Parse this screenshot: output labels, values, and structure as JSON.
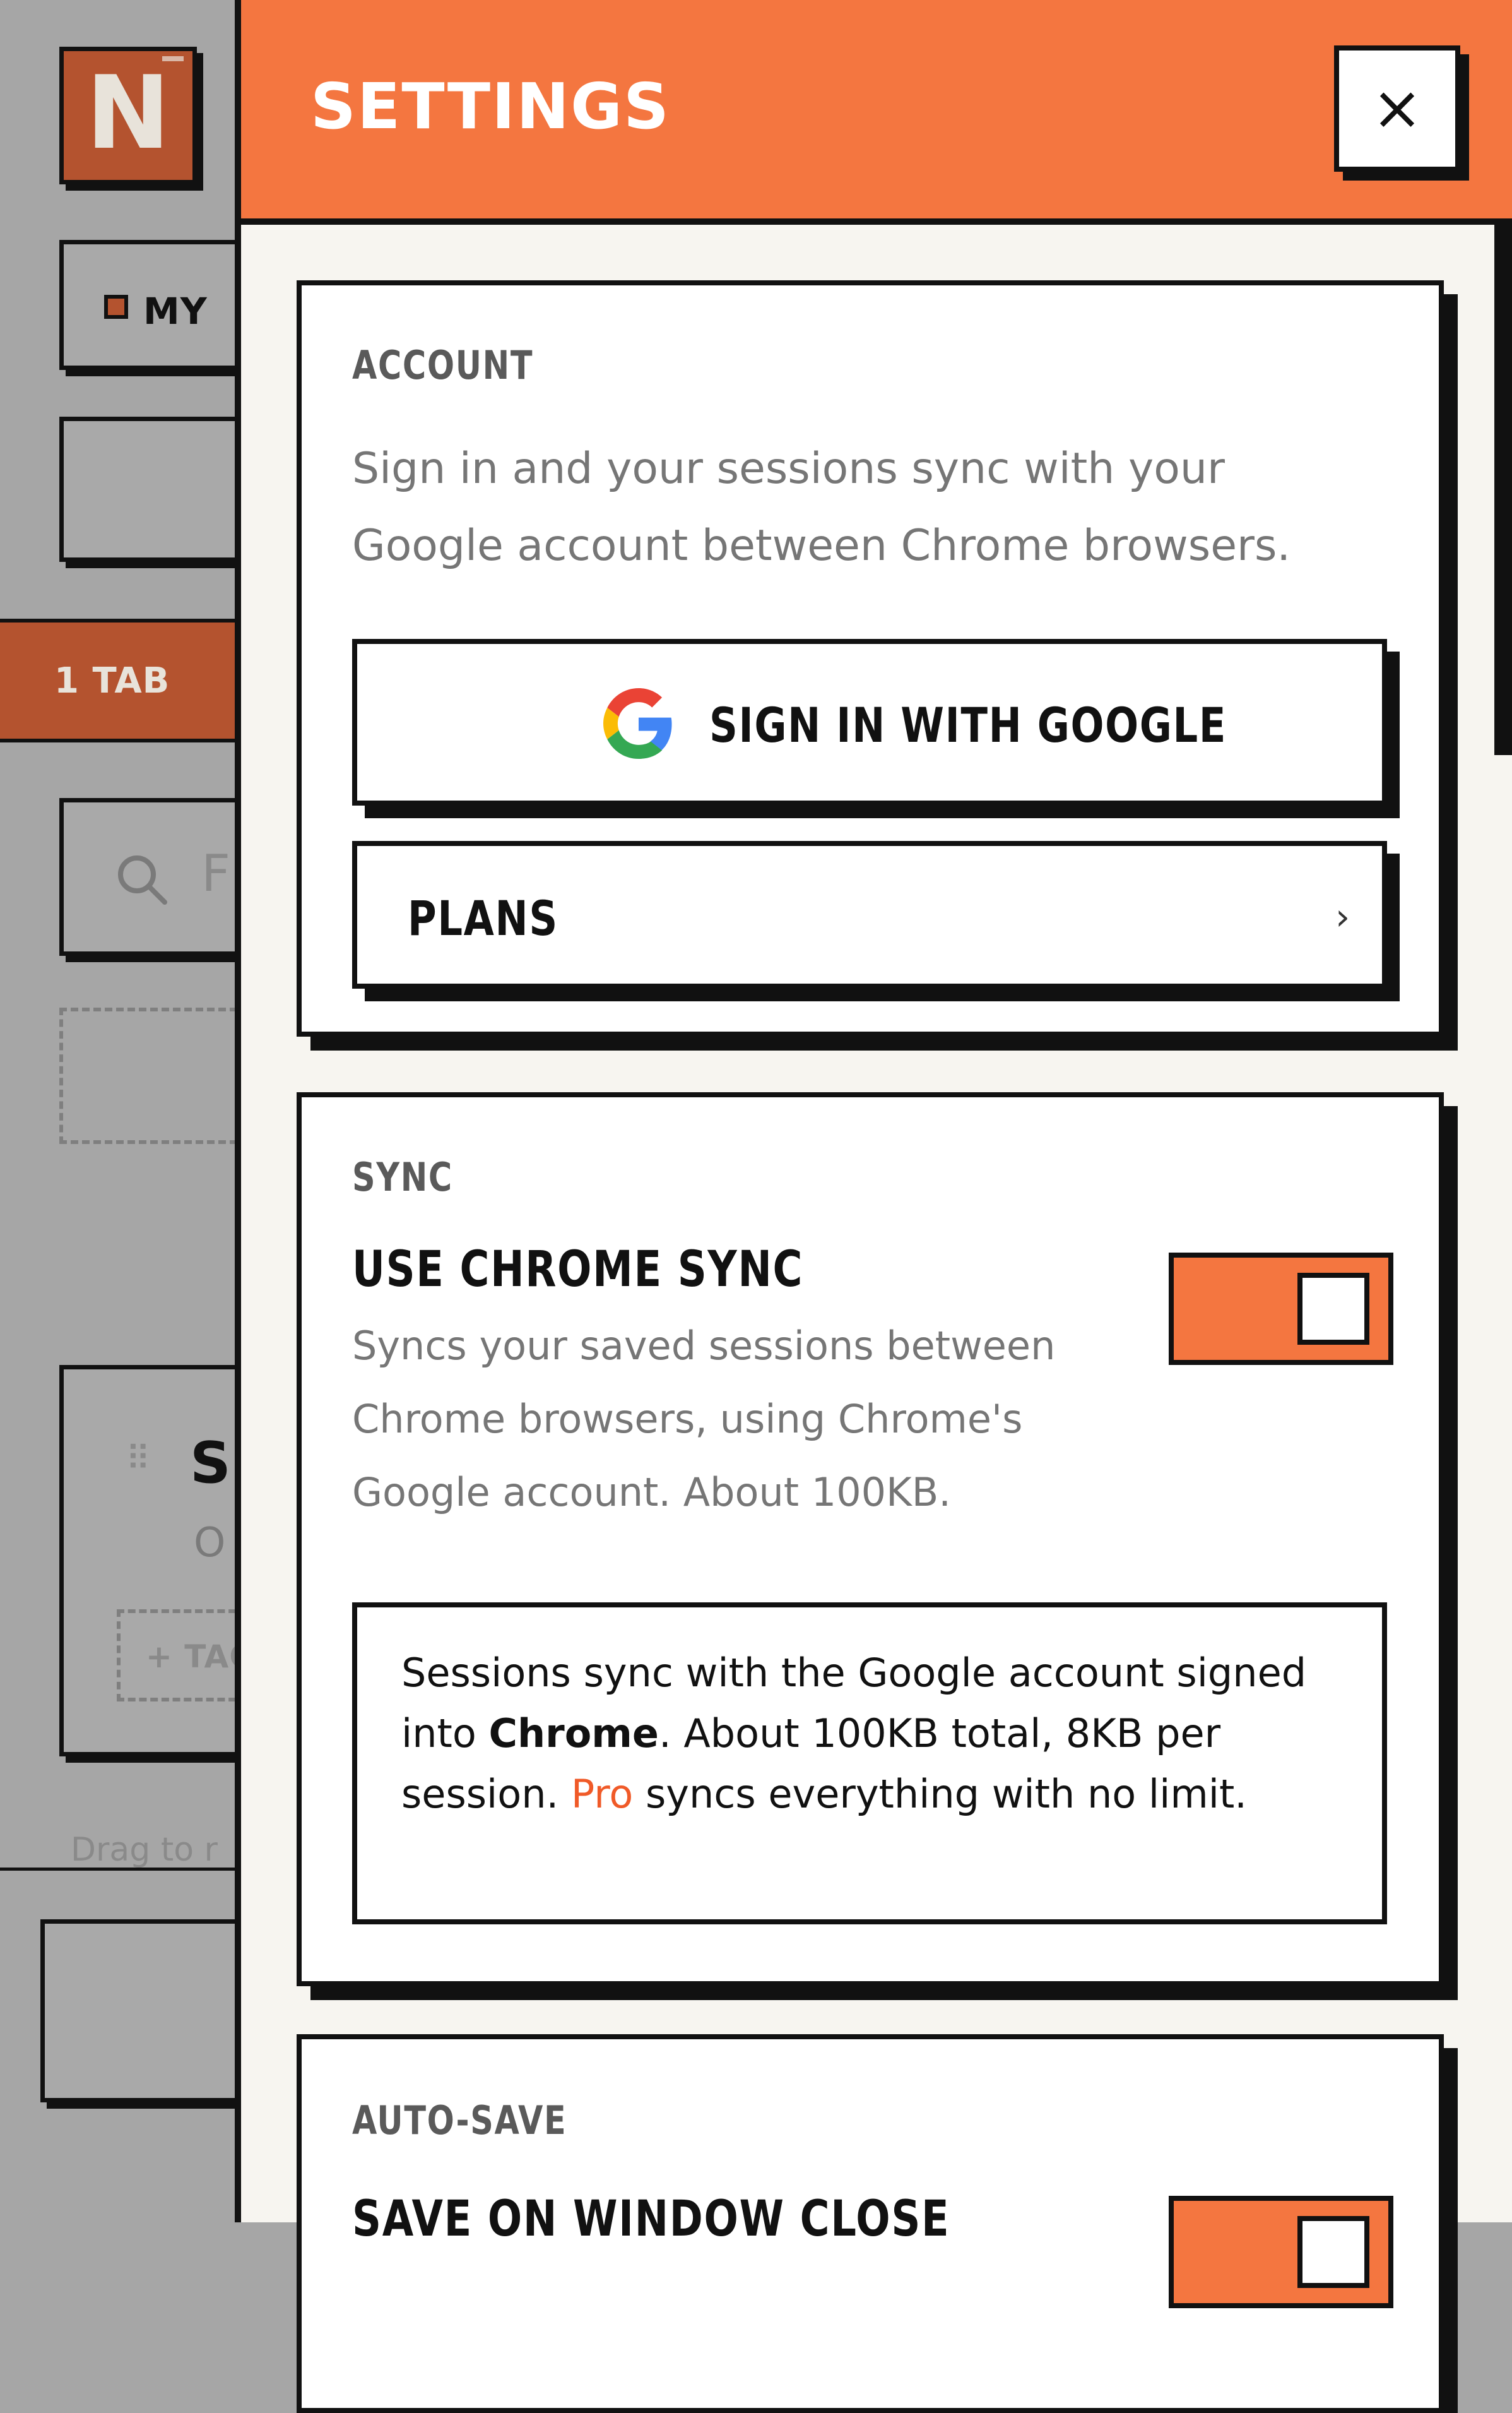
{
  "background": {
    "logo_letter": "N",
    "my_label": "MY",
    "tab_count_label": "1 TAB",
    "search_placeholder_fragment": "F",
    "card_title_fragment": "SI",
    "card_meta_fragment": "O",
    "tag_button_fragment": "+ TAG",
    "drag_hint_fragment": "Drag to r"
  },
  "settings": {
    "title": "SETTINGS",
    "close_glyph": "×",
    "account": {
      "section_label": "ACCOUNT",
      "description": "Sign in and your sessions sync with your Google account between Chrome browsers.",
      "sign_in_label": "SIGN IN WITH GOOGLE",
      "plans_label": "PLANS",
      "plans_chevron": "›"
    },
    "sync": {
      "section_label": "SYNC",
      "setting_title": "USE CHROME SYNC",
      "setting_description": "Syncs your saved sessions between Chrome browsers, using Chrome's Google account. About 100KB.",
      "toggle_on": true,
      "note": {
        "part1": "Sessions sync with the Google account signed into ",
        "bold": "Chrome",
        "part2": ". About 100KB total, 8KB per session. ",
        "pro": "Pro",
        "part3": " syncs everything with no limit."
      }
    },
    "auto_save": {
      "section_label": "AUTO-SAVE",
      "setting_title": "SAVE ON WINDOW CLOSE",
      "toggle_on": true
    }
  },
  "colors": {
    "accent": "#f47640",
    "pro_text": "#f05a28",
    "background_app_accent": "#b4532f"
  }
}
